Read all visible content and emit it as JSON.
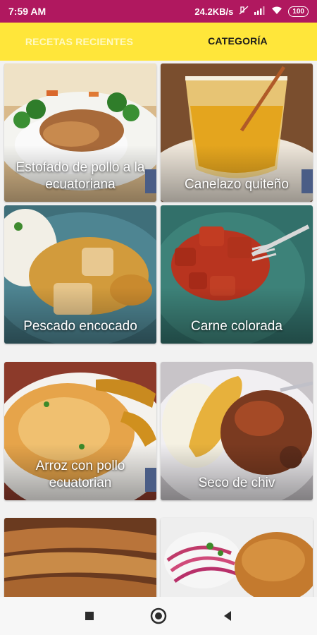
{
  "status_bar": {
    "time": "7:59 AM",
    "network_speed": "24.2KB/s",
    "battery": "100",
    "icons": [
      "no-sound-icon",
      "signal-icon",
      "wifi-icon",
      "battery-icon"
    ]
  },
  "tabs": [
    {
      "label": "RECETAS RECIENTES",
      "active": false
    },
    {
      "label": "CATEGORÍA",
      "active": true
    }
  ],
  "recipes": [
    {
      "title": "Estofado de pollo a la ecuatoriana"
    },
    {
      "title": "Canelazo quiteño"
    },
    {
      "title": "Pescado encocado"
    },
    {
      "title": "Carne colorada"
    },
    {
      "title": "Arroz con pollo ecuatorian"
    },
    {
      "title": "Seco de chiv"
    },
    {
      "title": ""
    },
    {
      "title": ""
    }
  ],
  "nav_bar": {
    "icons": [
      "recents-square-icon",
      "home-circle-icon",
      "back-triangle-icon"
    ]
  },
  "colors": {
    "status_bar": "#b0185f",
    "tab_bar": "#ffe63a"
  }
}
